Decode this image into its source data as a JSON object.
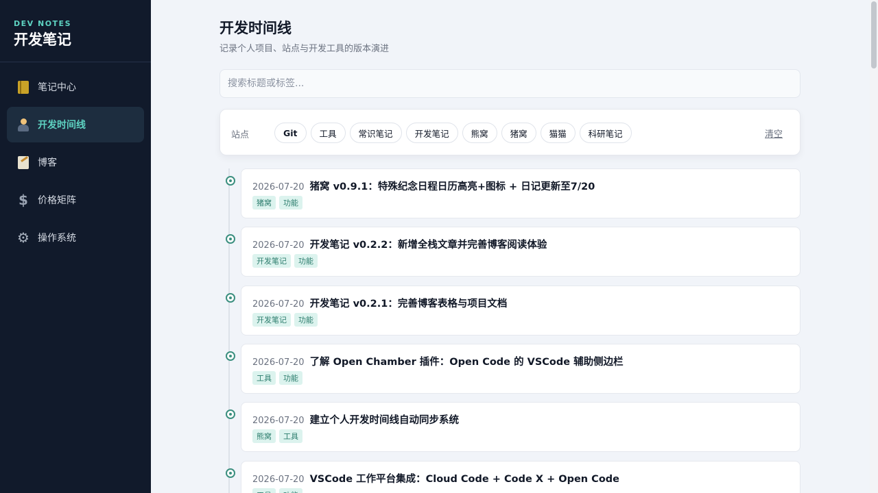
{
  "sidebar": {
    "brand_sub": "DEV NOTES",
    "brand_title": "开发笔记",
    "items": [
      {
        "label": "笔记中心",
        "icon": "notebook-icon"
      },
      {
        "label": "开发时间线",
        "icon": "person-icon",
        "active": true
      },
      {
        "label": "博客",
        "icon": "memo-icon"
      },
      {
        "label": "价格矩阵",
        "icon": "dollar-icon"
      },
      {
        "label": "操作系统",
        "icon": "gear-icon"
      }
    ]
  },
  "header": {
    "title": "开发时间线",
    "subtitle": "记录个人项目、站点与开发工具的版本演进"
  },
  "search": {
    "placeholder": "搜索标题或标签..."
  },
  "filter": {
    "label": "站点",
    "chips": [
      "Git",
      "工具",
      "常识笔记",
      "开发笔记",
      "熊窝",
      "猪窝",
      "猫猫",
      "科研笔记"
    ],
    "clear_label": "清空"
  },
  "timeline": [
    {
      "date": "2026-07-20",
      "title": "猪窝 v0.9.1：特殊纪念日程日历高亮+图标 + 日记更新至7/20",
      "tags": [
        "猪窝",
        "功能"
      ]
    },
    {
      "date": "2026-07-20",
      "title": "开发笔记 v0.2.2：新增全栈文章并完善博客阅读体验",
      "tags": [
        "开发笔记",
        "功能"
      ]
    },
    {
      "date": "2026-07-20",
      "title": "开发笔记 v0.2.1：完善博客表格与项目文档",
      "tags": [
        "开发笔记",
        "功能"
      ]
    },
    {
      "date": "2026-07-20",
      "title": "了解 Open Chamber 插件：Open Code 的 VSCode 辅助侧边栏",
      "tags": [
        "工具",
        "功能"
      ]
    },
    {
      "date": "2026-07-20",
      "title": "建立个人开发时间线自动同步系统",
      "tags": [
        "熊窝",
        "工具"
      ]
    },
    {
      "date": "2026-07-20",
      "title": "VSCode 工作平台集成：Cloud Code + Code X + Open Code",
      "tags": [
        "工具",
        "功能"
      ]
    }
  ],
  "colors": {
    "sidebar_bg": "#111a2b",
    "accent": "#5ed3c2",
    "timeline_dot": "#3b8f7f",
    "tag_bg": "#dcf3ee"
  }
}
